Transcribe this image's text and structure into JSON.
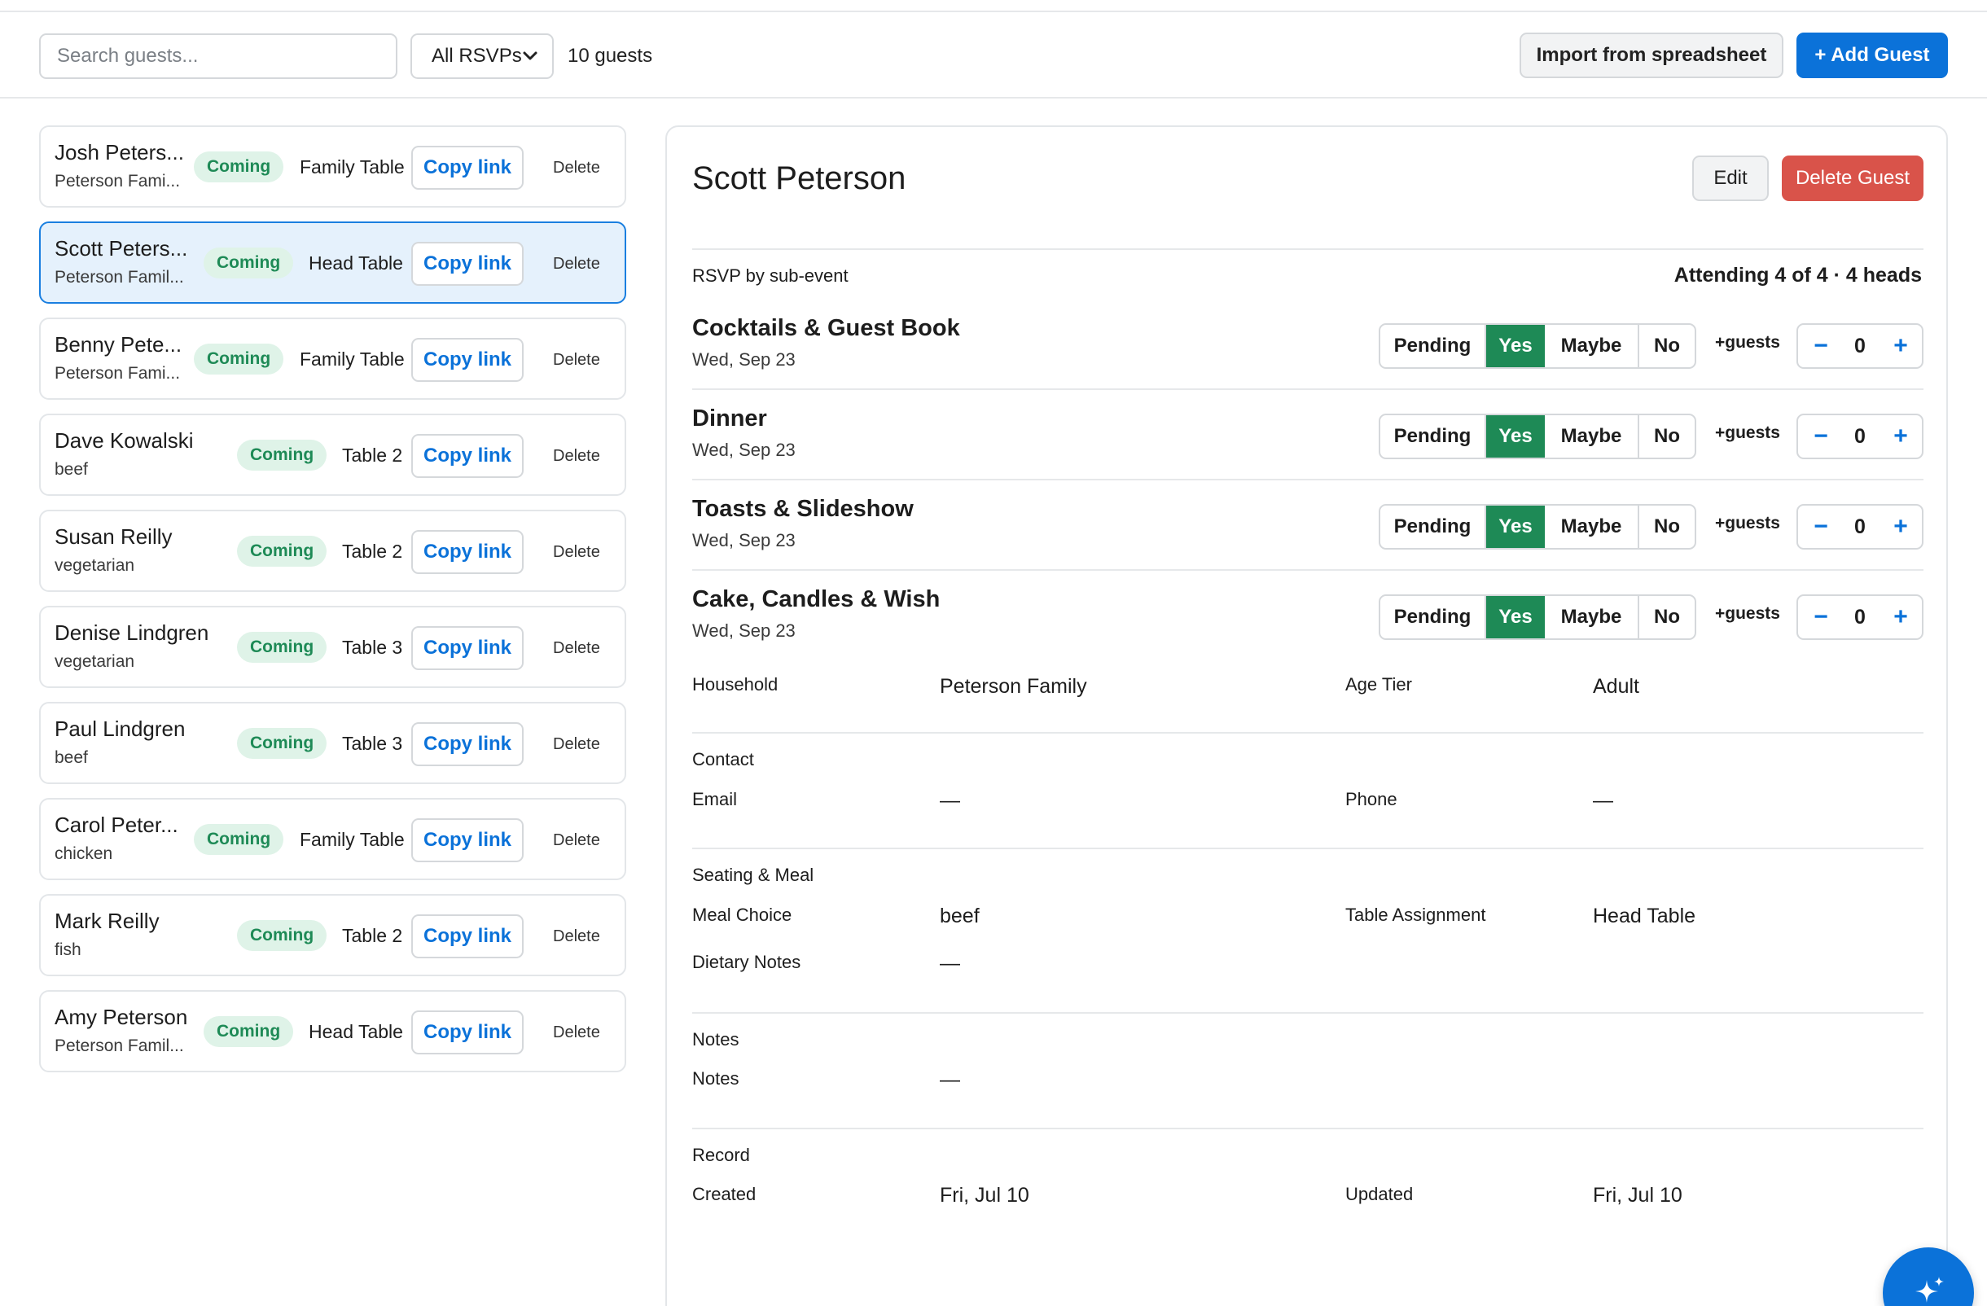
{
  "toolbar": {
    "search_placeholder": "Search guests...",
    "filter_selected": "All RSVPs",
    "guest_count": "10 guests",
    "import_label": "Import from spreadsheet",
    "add_label": "+ Add Guest"
  },
  "guests": [
    {
      "name": "Josh Peters...",
      "sub": "Peterson Fami...",
      "status": "Coming",
      "table": "Family Table",
      "copy": "Copy link",
      "delete": "Delete"
    },
    {
      "name": "Scott Peters...",
      "sub": "Peterson Famil...",
      "status": "Coming",
      "table": "Head Table",
      "copy": "Copy link",
      "delete": "Delete"
    },
    {
      "name": "Benny Pete...",
      "sub": "Peterson Fami...",
      "status": "Coming",
      "table": "Family Table",
      "copy": "Copy link",
      "delete": "Delete"
    },
    {
      "name": "Dave Kowalski",
      "sub": "beef",
      "status": "Coming",
      "table": "Table 2",
      "copy": "Copy link",
      "delete": "Delete"
    },
    {
      "name": "Susan Reilly",
      "sub": "vegetarian",
      "status": "Coming",
      "table": "Table 2",
      "copy": "Copy link",
      "delete": "Delete"
    },
    {
      "name": "Denise Lindgren",
      "sub": "vegetarian",
      "status": "Coming",
      "table": "Table 3",
      "copy": "Copy link",
      "delete": "Delete"
    },
    {
      "name": "Paul Lindgren",
      "sub": "beef",
      "status": "Coming",
      "table": "Table 3",
      "copy": "Copy link",
      "delete": "Delete"
    },
    {
      "name": "Carol Peter...",
      "sub": "chicken",
      "status": "Coming",
      "table": "Family Table",
      "copy": "Copy link",
      "delete": "Delete"
    },
    {
      "name": "Mark Reilly",
      "sub": "fish",
      "status": "Coming",
      "table": "Table 2",
      "copy": "Copy link",
      "delete": "Delete"
    },
    {
      "name": "Amy Peterson",
      "sub": "Peterson Famil...",
      "status": "Coming",
      "table": "Head Table",
      "copy": "Copy link",
      "delete": "Delete"
    }
  ],
  "detail": {
    "title": "Scott Peterson",
    "edit_label": "Edit",
    "delete_label": "Delete Guest",
    "rsvp_label": "RSVP by sub-event",
    "attending": "Attending 4 of 4 · 4 heads",
    "plus_guests_label": "+guests",
    "rsvp_options": [
      "Pending",
      "Yes",
      "Maybe",
      "No"
    ],
    "events": [
      {
        "name": "Cocktails & Guest Book",
        "date": "Wed, Sep 23",
        "selected": "Yes",
        "extra": "0"
      },
      {
        "name": "Dinner",
        "date": "Wed, Sep 23",
        "selected": "Yes",
        "extra": "0"
      },
      {
        "name": "Toasts & Slideshow",
        "date": "Wed, Sep 23",
        "selected": "Yes",
        "extra": "0"
      },
      {
        "name": "Cake, Candles & Wish",
        "date": "Wed, Sep 23",
        "selected": "Yes",
        "extra": "0"
      }
    ],
    "household_label": "Household",
    "household_value": "Peterson Family",
    "age_label": "Age Tier",
    "age_value": "Adult",
    "contact_title": "Contact",
    "email_label": "Email",
    "email_value": "—",
    "phone_label": "Phone",
    "phone_value": "—",
    "seating_title": "Seating & Meal",
    "meal_label": "Meal Choice",
    "meal_value": "beef",
    "table_label": "Table Assignment",
    "table_value": "Head Table",
    "dietary_label": "Dietary Notes",
    "dietary_value": "—",
    "notes_title": "Notes",
    "notes_label": "Notes",
    "notes_value": "—",
    "record_title": "Record",
    "created_label": "Created",
    "created_value": "Fri, Jul 10",
    "updated_label": "Updated",
    "updated_value": "Fri, Jul 10"
  },
  "colors": {
    "accent": "#0b72d9",
    "coming_badge_bg": "#dff3e8",
    "coming_badge_text": "#1e8a56",
    "yes_selected": "#1e8a56",
    "delete_guest": "#d9534a",
    "selected_row_bg": "#e5f1fc"
  },
  "icons": {
    "filter_chevron": "chevron-down-icon",
    "fab": "sparkle-icon"
  }
}
